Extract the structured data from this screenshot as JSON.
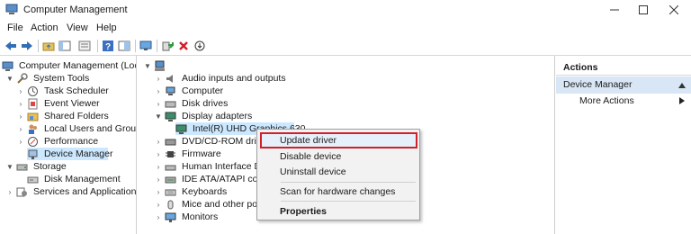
{
  "window": {
    "title": "Computer Management",
    "icon": "computer-management-icon"
  },
  "menu": [
    "File",
    "Action",
    "View",
    "Help"
  ],
  "left_tree": {
    "root": "Computer Management (Local",
    "system_tools": "System Tools",
    "task_scheduler": "Task Scheduler",
    "event_viewer": "Event Viewer",
    "shared_folders": "Shared Folders",
    "local_users": "Local Users and Groups",
    "performance": "Performance",
    "device_manager": "Device Manager",
    "storage": "Storage",
    "disk_management": "Disk Management",
    "services": "Services and Applications"
  },
  "devices": {
    "audio": "Audio inputs and outputs",
    "computer": "Computer",
    "disk_drives": "Disk drives",
    "display_adapters": "Display adapters",
    "gpu": "Intel(R) UHD Graphics 630",
    "dvd": "DVD/CD-ROM drives",
    "firmware": "Firmware",
    "hid": "Human Interface Dev",
    "ide": "IDE ATA/ATAPI contr",
    "keyboards": "Keyboards",
    "mice": "Mice and other poin",
    "monitors": "Monitors"
  },
  "context_menu": {
    "update_driver": "Update driver",
    "disable_device": "Disable device",
    "uninstall_device": "Uninstall device",
    "scan": "Scan for hardware changes",
    "properties": "Properties"
  },
  "actions": {
    "header": "Actions",
    "device_manager": "Device Manager",
    "more_actions": "More Actions"
  },
  "colors": {
    "selection": "#cce8ff",
    "highlight_border": "#d0202a",
    "actions_band": "#d9e6f5"
  }
}
